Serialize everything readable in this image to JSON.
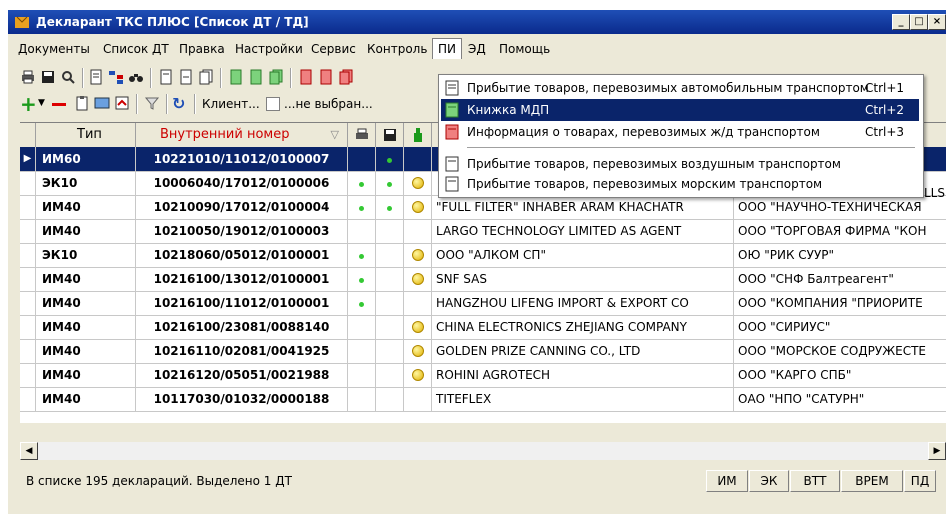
{
  "window": {
    "title": "Декларант ТКС ПЛЮС [Список ДТ / ТД]"
  },
  "menu": [
    "Документы",
    "Список ДТ",
    "Правка",
    "Настройки",
    "Сервис",
    "Контроль",
    "ПИ",
    "ЭД",
    "Помощь"
  ],
  "toolbar2": {
    "client_label": "Клиент...",
    "not_selected_label": "...не выбран..."
  },
  "grid": {
    "headers": {
      "type": "Тип",
      "internal_number": "Внутренний номер",
      "sort_indicator": "▽"
    },
    "rows": [
      {
        "type": "ИМ60",
        "number": "10221010/11012/0100007",
        "dot1": false,
        "dot2": true,
        "flag": false,
        "sender": "",
        "recipient": "",
        "selected": true
      },
      {
        "type": "ЭК10",
        "number": "10006040/17012/0100006",
        "dot1": true,
        "dot2": true,
        "flag": true,
        "sender": "",
        "recipient": "",
        "selected": false
      },
      {
        "type": "ИМ40",
        "number": "10210090/17012/0100004",
        "dot1": true,
        "dot2": true,
        "flag": true,
        "sender": "\"FULL FILTER\" INHABER ARAM KHACHATR",
        "recipient": "ООО \"НАУЧНО-ТЕХНИЧЕСКАЯ",
        "selected": false
      },
      {
        "type": "ИМ40",
        "number": "10210050/19012/0100003",
        "dot1": false,
        "dot2": false,
        "flag": false,
        "sender": "LARGO TECHNOLOGY LIMITED AS AGENT",
        "recipient": "ООО \"ТОРГОВАЯ ФИРМА \"КОН",
        "selected": false
      },
      {
        "type": "ЭК10",
        "number": "10218060/05012/0100001",
        "dot1": true,
        "dot2": false,
        "flag": true,
        "sender": "ООО \"АЛКОМ СП\"",
        "recipient": "ОЮ \"РИК СУУР\"",
        "selected": false
      },
      {
        "type": "ИМ40",
        "number": "10216100/13012/0100001",
        "dot1": true,
        "dot2": false,
        "flag": true,
        "sender": "SNF SAS",
        "recipient": "ООО \"СНФ Балтреагент\"",
        "selected": false
      },
      {
        "type": "ИМ40",
        "number": "10216100/11012/0100001",
        "dot1": true,
        "dot2": false,
        "flag": false,
        "sender": "HANGZHOU LIFENG IMPORT & EXPORT CO",
        "recipient": "ООО \"КОМПАНИЯ \"ПРИОРИТЕ",
        "selected": false
      },
      {
        "type": "ИМ40",
        "number": "10216100/23081/0088140",
        "dot1": false,
        "dot2": false,
        "flag": true,
        "sender": "CHINA ELECTRONICS ZHEJIANG COMPANY",
        "recipient": "ООО \"СИРИУС\"",
        "selected": false
      },
      {
        "type": "ИМ40",
        "number": "10216110/02081/0041925",
        "dot1": false,
        "dot2": false,
        "flag": true,
        "sender": "GOLDEN PRIZE CANNING CO., LTD",
        "recipient": "ООО \"МОРСКОЕ СОДРУЖЕСТЕ",
        "selected": false
      },
      {
        "type": "ИМ40",
        "number": "10216120/05051/0021988",
        "dot1": false,
        "dot2": false,
        "flag": true,
        "sender": "ROHINI AGROTECH",
        "recipient": "ООО \"КАРГО СПБ\"",
        "selected": false
      },
      {
        "type": "ИМ40",
        "number": "10117030/01032/0000188",
        "dot1": false,
        "dot2": false,
        "flag": false,
        "sender": "TITEFLEX",
        "recipient": "ОАО \"НПО \"САТУРН\"",
        "selected": false
      }
    ]
  },
  "dropdown": {
    "items": [
      {
        "label": "Прибытие товаров, перевозимых автомобильным транспортом",
        "shortcut": "Ctrl+1",
        "highlight": false,
        "icon": "document-icon"
      },
      {
        "label": "Книжка МДП",
        "shortcut": "Ctrl+2",
        "highlight": true,
        "icon": "green-document-icon"
      },
      {
        "label": "Информация о товарах, перевозимых ж/д транспортом",
        "shortcut": "Ctrl+3",
        "highlight": false,
        "icon": "red-document-icon"
      },
      {
        "label": "Прибытие товаров, перевозимых воздушным транспортом",
        "shortcut": "",
        "highlight": false,
        "icon": "document-icon"
      },
      {
        "label": "Прибытие товаров, перевозимых морским транспортом",
        "shortcut": "",
        "highlight": false,
        "icon": "document-icon"
      }
    ],
    "partial_hidden_text": "LLS"
  },
  "status": {
    "text": "В списке 195 деклараций. Выделено 1 ДТ",
    "buttons": [
      "ИМ",
      "ЭК",
      "ВТТ",
      "ВРЕМ",
      "ПД"
    ]
  },
  "colors": {
    "selection": "#0a246a",
    "title_bar": "#0a2a8c",
    "header_red": "#cc0000"
  }
}
